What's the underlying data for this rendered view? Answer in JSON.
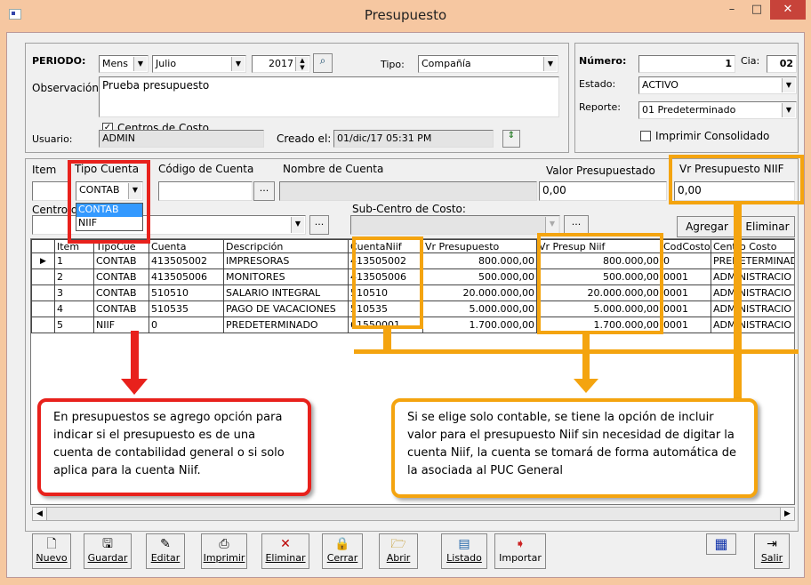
{
  "window": {
    "title": "Presupuesto",
    "minimize": "–",
    "maximize": "□",
    "close": "✕"
  },
  "header": {
    "periodo_label": "PERIODO:",
    "period_type": "Mens",
    "month": "Julio",
    "year": "2017",
    "tipo_label": "Tipo:",
    "tipo_value": "Compañía",
    "observacion_label": "Observación:",
    "observacion_value": "Prueba presupuesto",
    "centros_label": "Centros de Costo",
    "usuario_label": "Usuario:",
    "usuario_value": "ADMIN",
    "creado_label": "Creado el:",
    "creado_value": "01/dic/17 05:31 PM"
  },
  "right_panel": {
    "numero_label": "Número:",
    "numero_value": "1",
    "cia_label": "Cia:",
    "cia_value": "02",
    "estado_label": "Estado:",
    "estado_value": "ACTIVO",
    "reporte_label": "Reporte:",
    "reporte_value": "01 Predeterminado",
    "imprimir_label": "Imprimir Consolidado"
  },
  "detail": {
    "item_label": "Item",
    "tipo_cuenta_label": "Tipo Cuenta",
    "codigo_label": "Código de Cuenta",
    "nombre_label": "Nombre de Cuenta",
    "valor_label": "Valor Presupuestado",
    "valor_value": "0,00",
    "vr_niif_label": "Vr Presupuesto NIIF",
    "vr_niif_value": "0,00",
    "tipo_selected": "CONTAB",
    "tipo_options": [
      "CONTAB",
      "NIIF"
    ],
    "centro_label": "Centro d",
    "subcentro_label": "Sub-Centro de Costo:",
    "ellipsis": "...",
    "agregar": "Agregar",
    "eliminar": "Eliminar"
  },
  "grid": {
    "columns": [
      "Item",
      "TipoCue",
      "Cuenta",
      "Descripción",
      "CuentaNiif",
      "Vr Presupuesto",
      "Vr Presup Niif",
      "CodCosto",
      "Centro Costo"
    ],
    "rows": [
      [
        "1",
        "CONTAB",
        "413505002",
        "IMPRESORAS",
        "413505002",
        "800.000,00",
        "800.000,00",
        "0",
        "PREDETERMINAD"
      ],
      [
        "2",
        "CONTAB",
        "413505006",
        "MONITORES",
        "413505006",
        "500.000,00",
        "500.000,00",
        "0001",
        "ADMINISTRACIO"
      ],
      [
        "3",
        "CONTAB",
        "510510",
        "SALARIO INTEGRAL",
        "510510",
        "20.000.000,00",
        "20.000.000,00",
        "0001",
        "ADMINISTRACIO"
      ],
      [
        "4",
        "CONTAB",
        "510535",
        "PAGO DE VACACIONES",
        "510535",
        "5.000.000,00",
        "5.000.000,00",
        "0001",
        "ADMINISTRACIO"
      ],
      [
        "5",
        "NIIF",
        "0",
        "PREDETERMINADO",
        "61550001",
        "1.700.000,00",
        "1.700.000,00",
        "0001",
        "ADMINISTRACIO"
      ]
    ]
  },
  "callouts": {
    "red": "En presupuestos se agrego opción para indicar si el presupuesto es de una cuenta de contabilidad general o si solo aplica para la cuenta Niif.",
    "orange": "Si se elige solo contable, se tiene la opción de incluir valor para el presupuesto Niif sin necesidad de digitar la cuenta Niif, la cuenta se tomará de forma automática de la asociada al PUC General"
  },
  "toolbar": {
    "nuevo": "Nuevo",
    "guardar": "Guardar",
    "editar": "Editar",
    "imprimir": "Imprimir",
    "eliminar": "Eliminar",
    "cerrar": "Cerrar",
    "abrir": "Abrir",
    "listado": "Listado",
    "importar": "Importar",
    "salir": "Salir"
  },
  "colors": {
    "red": "#e8211c",
    "orange": "#f4a40f",
    "title_bar": "#f6c7a1"
  }
}
